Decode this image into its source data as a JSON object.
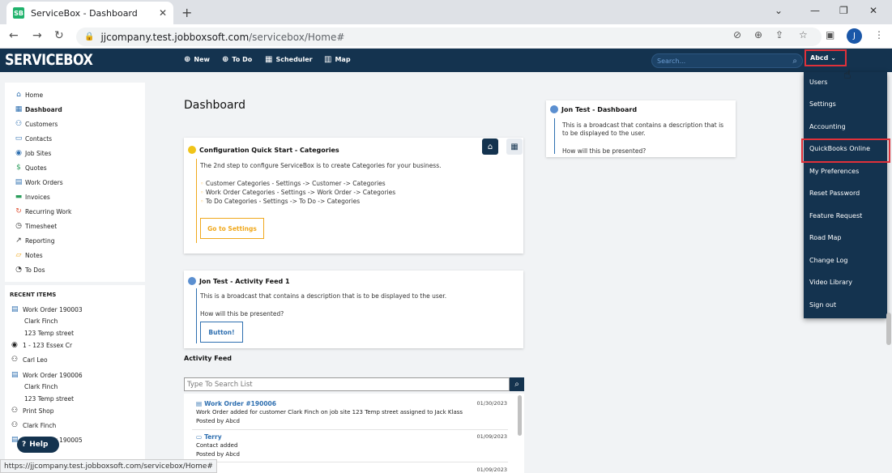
{
  "browser": {
    "tab_title": "ServiceBox - Dashboard",
    "favicon_text": "SB",
    "url_host": "jjcompany.test.jobboxsoft.com",
    "url_path": "/servicebox/Home#",
    "profile_initial": "J",
    "status_url": "https://jjcompany.test.jobboxsoft.com/servicebox/Home#"
  },
  "header": {
    "logo": "SERVICEBOX",
    "nav": [
      {
        "icon": "plus-circle-icon",
        "label": "New"
      },
      {
        "icon": "plus-circle-icon",
        "label": "To Do"
      },
      {
        "icon": "calendar-icon",
        "label": "Scheduler"
      },
      {
        "icon": "map-icon",
        "label": "Map"
      }
    ],
    "search_placeholder": "Search...",
    "user_label": "Abcd"
  },
  "user_menu": {
    "items": [
      "Users",
      "Settings",
      "Accounting",
      "QuickBooks Online",
      "My Preferences",
      "Reset Password",
      "Feature Request",
      "Road Map",
      "Change Log",
      "Video Library",
      "Sign out"
    ],
    "highlighted": "QuickBooks Online"
  },
  "sidebar": {
    "items": [
      {
        "icon": "home-icon",
        "label": "Home"
      },
      {
        "icon": "dashboard-icon",
        "label": "Dashboard"
      },
      {
        "icon": "users-icon",
        "label": "Customers"
      },
      {
        "icon": "contacts-icon",
        "label": "Contacts"
      },
      {
        "icon": "location-icon",
        "label": "Job Sites"
      },
      {
        "icon": "dollar-icon",
        "label": "Quotes"
      },
      {
        "icon": "document-icon",
        "label": "Work Orders"
      },
      {
        "icon": "invoice-icon",
        "label": "Invoices"
      },
      {
        "icon": "recurring-icon",
        "label": "Recurring Work"
      },
      {
        "icon": "stopwatch-icon",
        "label": "Timesheet"
      },
      {
        "icon": "chart-line-icon",
        "label": "Reporting"
      },
      {
        "icon": "note-icon",
        "label": "Notes"
      },
      {
        "icon": "clock-icon",
        "label": "To Dos"
      }
    ],
    "recent_title": "RECENT ITEMS",
    "recent": [
      {
        "icon": "document-icon",
        "label": "Work Order 190003",
        "sub": false
      },
      {
        "icon": "",
        "label": "Clark Finch",
        "sub": true
      },
      {
        "icon": "",
        "label": "123 Temp street",
        "sub": true
      },
      {
        "icon": "location-icon",
        "label": "1 - 123 Essex Cr",
        "sub": false
      },
      {
        "icon": "users-icon",
        "label": "Carl Leo",
        "sub": false
      },
      {
        "icon": "document-icon",
        "label": "Work Order 190006",
        "sub": false
      },
      {
        "icon": "",
        "label": "Clark Finch",
        "sub": true
      },
      {
        "icon": "",
        "label": "123 Temp street",
        "sub": true
      },
      {
        "icon": "users-icon",
        "label": "Print Shop",
        "sub": false
      },
      {
        "icon": "users-icon",
        "label": "Clark Finch",
        "sub": false
      },
      {
        "icon": "document-icon",
        "label": "Work Order 190005",
        "sub": false
      }
    ],
    "help_label": "Help"
  },
  "main": {
    "title": "Dashboard",
    "config_card": {
      "title": "Configuration Quick Start - Categories",
      "intro": "The 2nd step to configure ServiceBox is to create Categories for your business.",
      "lines": [
        "Customer Categories - Settings -> Customer -> Categories",
        "Work Order Categories - Settings -> Work Order -> Categories",
        "To Do Categories - Settings -> To Do -> Categories"
      ],
      "button": "Go to Settings"
    },
    "activity_card": {
      "title": "Jon Test - Activity Feed 1",
      "text": "This is a broadcast that contains a description that is to be displayed to the user.",
      "question": "How will this be presented?",
      "button": "Button!"
    },
    "dashboard_card": {
      "title": "Jon Test - Dashboard",
      "text_line1": "This is a broadcast that contains a description that is",
      "text_line2": "to be displayed to the user.",
      "question": "How will this be presented?"
    },
    "activity_feed": {
      "title": "Activity Feed",
      "search_placeholder": "Type To Search List",
      "items": [
        {
          "title": "Work Order #190006",
          "date": "01/30/2023",
          "line1": "Work Order added for customer Clark Finch on job site 123 Temp street assigned to Jack Klass",
          "line2": "Posted by Abcd"
        },
        {
          "title": "Terry",
          "date": "01/09/2023",
          "line1": "Contact added",
          "line2": "Posted by Abcd"
        },
        {
          "title": "",
          "date": "01/09/2023",
          "line1": "",
          "line2": ""
        }
      ]
    }
  },
  "colors": {
    "header_bg": "#14334f",
    "accent_blue": "#2e6fb0",
    "accent_orange": "#f0a81c",
    "highlight_red": "#e0313a"
  }
}
